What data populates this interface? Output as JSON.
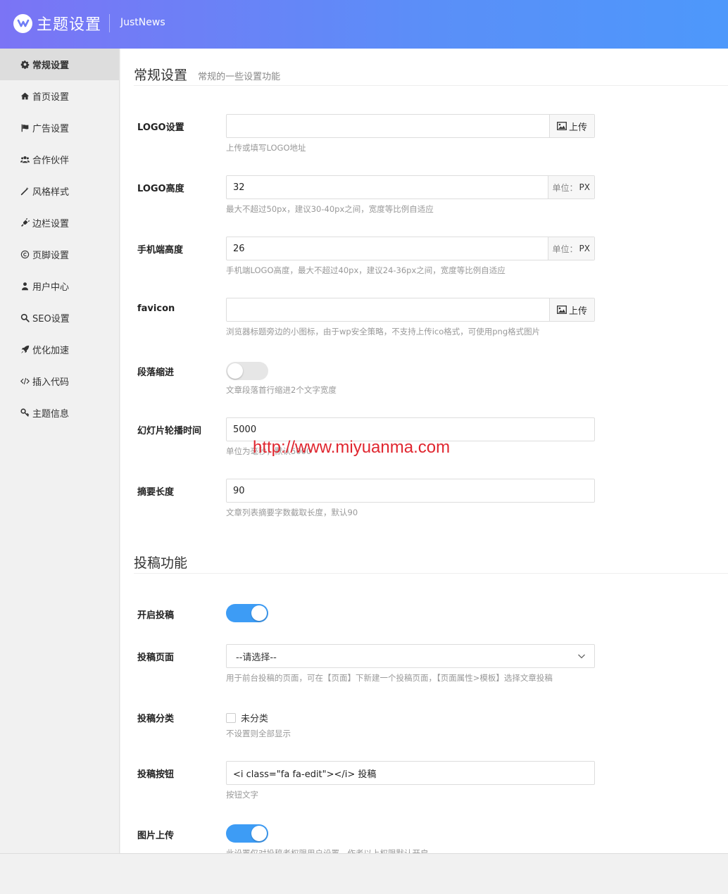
{
  "header": {
    "title": "主题设置",
    "theme_name": "JustNews"
  },
  "sidebar": {
    "items": [
      {
        "label": "常规设置",
        "icon": "gear-icon",
        "active": true
      },
      {
        "label": "首页设置",
        "icon": "home-icon",
        "active": false
      },
      {
        "label": "广告设置",
        "icon": "flag-icon",
        "active": false
      },
      {
        "label": "合作伙伴",
        "icon": "users-icon",
        "active": false
      },
      {
        "label": "风格样式",
        "icon": "magic-wand-icon",
        "active": false
      },
      {
        "label": "边栏设置",
        "icon": "plug-icon",
        "active": false
      },
      {
        "label": "页脚设置",
        "icon": "copyright-icon",
        "active": false
      },
      {
        "label": "用户中心",
        "icon": "user-icon",
        "active": false
      },
      {
        "label": "SEO设置",
        "icon": "search-icon",
        "active": false
      },
      {
        "label": "优化加速",
        "icon": "rocket-icon",
        "active": false
      },
      {
        "label": "插入代码",
        "icon": "code-icon",
        "active": false
      },
      {
        "label": "主题信息",
        "icon": "key-icon",
        "active": false
      }
    ]
  },
  "general": {
    "title": "常规设置",
    "subtitle": "常规的一些设置功能",
    "logo": {
      "label": "LOGO设置",
      "value": "",
      "button": "上传",
      "help": "上传或填写LOGO地址"
    },
    "logo_height": {
      "label": "LOGO高度",
      "value": "32",
      "unit_prefix": "单位：",
      "unit": "PX",
      "help": "最大不超过50px，建议30-40px之间，宽度等比例自适应"
    },
    "mobile_height": {
      "label": "手机端高度",
      "value": "26",
      "unit_prefix": "单位：",
      "unit": "PX",
      "help": "手机端LOGO高度，最大不超过40px，建议24-36px之间，宽度等比例自适应"
    },
    "favicon": {
      "label": "favicon",
      "value": "",
      "button": "上传",
      "help": "浏览器标题旁边的小图标，由于wp安全策略，不支持上传ico格式，可使用png格式图片"
    },
    "indent": {
      "label": "段落缩进",
      "enabled": false,
      "help": "文章段落首行缩进2个文字宽度"
    },
    "slide_time": {
      "label": "幻灯片轮播时间",
      "value": "5000",
      "help": "单位为毫秒，默认5000"
    },
    "excerpt": {
      "label": "摘要长度",
      "value": "90",
      "help": "文章列表摘要字数截取长度，默认90"
    }
  },
  "submit": {
    "title": "投稿功能",
    "enable": {
      "label": "开启投稿",
      "enabled": true
    },
    "page": {
      "label": "投稿页面",
      "selected": "--请选择--",
      "help": "用于前台投稿的页面，可在【页面】下新建一个投稿页面，【页面属性>模板】选择文章投稿"
    },
    "category": {
      "label": "投稿分类",
      "option": "未分类",
      "checked": false,
      "help": "不设置则全部显示"
    },
    "button": {
      "label": "投稿按钮",
      "value": "<i class=\"fa fa-edit\"></i> 投稿",
      "help": "按钮文字"
    },
    "image_upload": {
      "label": "图片上传",
      "enabled": true,
      "help": "此设置仅对投稿者权限用户设置，作者以上权限默认开启"
    }
  },
  "watermark": "http://www.miyuanma.com"
}
